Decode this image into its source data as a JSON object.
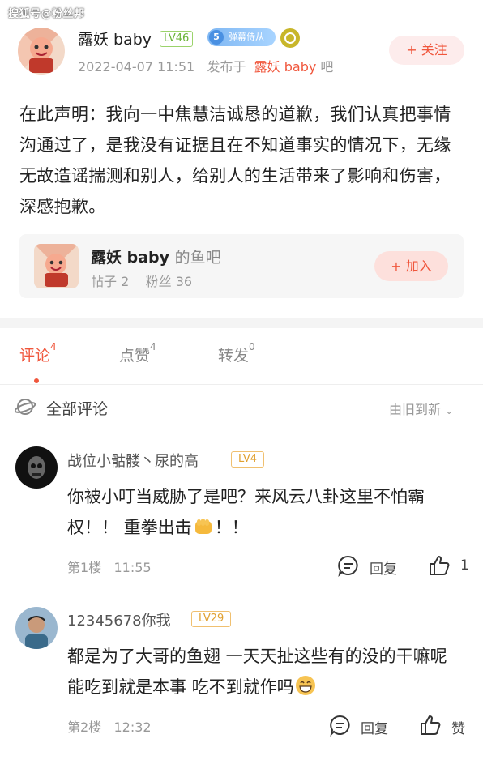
{
  "watermark": "搜狐号@粉丝邦",
  "post": {
    "author": "露妖 baby",
    "level": "LV46",
    "title_badge_num": "5",
    "title_badge": "弹幕侍从",
    "date": "2022-04-07 11:51",
    "published_in": "发布于",
    "forum": "露妖 baby",
    "forum_suffix": "吧",
    "follow": "+ 关注",
    "body": "在此声明：我向一中焦慧洁诚恳的道歉，我们认真把事情沟通过了，是我没有证据且在不知道事实的情况下，无缘无故造谣揣测和别人，给别人的生活带来了影响和伤害，深感抱歉。"
  },
  "forum_card": {
    "name": "露妖 baby",
    "suffix": "的鱼吧",
    "posts": "帖子 2",
    "fans": "粉丝 36",
    "join": "+ 加入"
  },
  "tabs": [
    {
      "label": "评论",
      "count": "4"
    },
    {
      "label": "点赞",
      "count": "4"
    },
    {
      "label": "转发",
      "count": "0"
    }
  ],
  "comments_section": {
    "title": "全部评论",
    "sort": "由旧到新"
  },
  "comments": [
    {
      "user": "战位小骷髅丶尿的高",
      "level": "LV4",
      "text": "你被小叮当威胁了是吧？来风云八卦这里不怕霸权！！ 重拳出击",
      "text_tail": "！！",
      "floor": "第1楼",
      "time": "11:55",
      "reply": "回复",
      "likes": "1"
    },
    {
      "user": "12345678你我",
      "level": "LV29",
      "text": "都是为了大哥的鱼翅 一天天扯这些有的没的干嘛呢 能吃到就是本事 吃不到就作吗",
      "floor": "第2楼",
      "time": "12:32",
      "reply": "回复",
      "likes": "赞"
    }
  ],
  "colors": {
    "accent": "#f0563c",
    "level_green": "#6cb43a",
    "level_orange": "#e0a030"
  }
}
